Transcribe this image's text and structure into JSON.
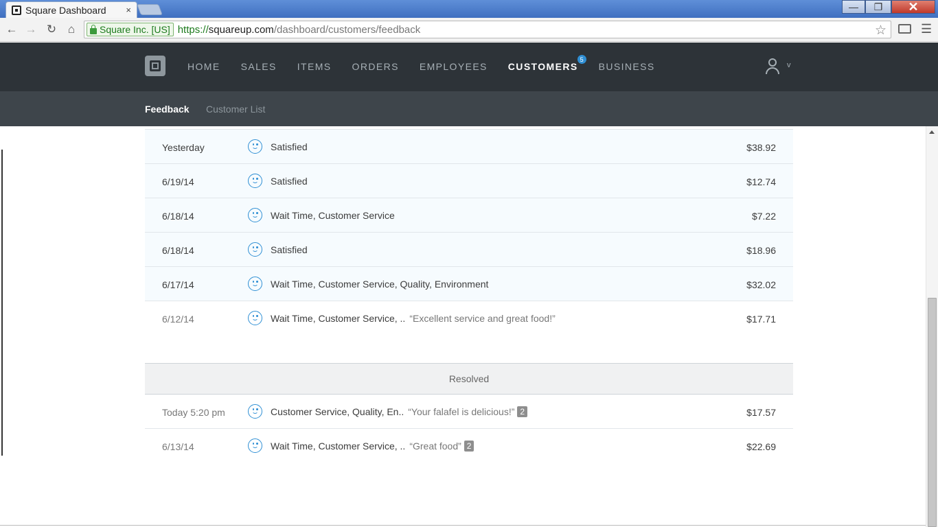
{
  "browser": {
    "tab_title": "Square Dashboard",
    "tab_close": "×",
    "ev_name": "Square Inc. [US]",
    "url_scheme": "https://",
    "url_host": "squareup.com",
    "url_path": "/dashboard/customers/feedback",
    "icons": [
      "back-icon",
      "forward-icon",
      "reload-icon",
      "home-icon",
      "lock-icon",
      "star-icon",
      "cast-icon",
      "menu-icon"
    ]
  },
  "nav": {
    "items": [
      {
        "label": "HOME"
      },
      {
        "label": "SALES"
      },
      {
        "label": "ITEMS"
      },
      {
        "label": "ORDERS"
      },
      {
        "label": "EMPLOYEES"
      },
      {
        "label": "CUSTOMERS",
        "active": true,
        "badge": "5"
      },
      {
        "label": "BUSINESS"
      }
    ],
    "user_caret": "v"
  },
  "subnav": {
    "feedback": "Feedback",
    "customer_list": "Customer List"
  },
  "feedback": [
    {
      "date": "Yesterday",
      "tags": "Satisfied",
      "quote": "",
      "count": "",
      "amount": "$38.92"
    },
    {
      "date": "6/19/14",
      "tags": "Satisfied",
      "quote": "",
      "count": "",
      "amount": "$12.74"
    },
    {
      "date": "6/18/14",
      "tags": "Wait Time, Customer Service",
      "quote": "",
      "count": "",
      "amount": "$7.22"
    },
    {
      "date": "6/18/14",
      "tags": "Satisfied",
      "quote": "",
      "count": "",
      "amount": "$18.96"
    },
    {
      "date": "6/17/14",
      "tags": "Wait Time, Customer Service, Quality, Environment",
      "quote": "",
      "count": "",
      "amount": "$32.02"
    },
    {
      "date": "6/12/14",
      "tags": "Wait Time, Customer Service, ..",
      "quote": "“Excellent service and great food!”",
      "count": "",
      "amount": "$17.71"
    }
  ],
  "resolved_label": "Resolved",
  "resolved": [
    {
      "date": "Today 5:20 pm",
      "tags": "Customer Service, Quality, En..",
      "quote": "“Your falafel is delicious!”",
      "count": "2",
      "amount": "$17.57"
    },
    {
      "date": "6/13/14",
      "tags": "Wait Time, Customer Service, ..",
      "quote": "“Great food”",
      "count": "2",
      "amount": "$22.69"
    }
  ],
  "colors": {
    "header_bg": "#2d3338",
    "subnav_bg": "#3e454b",
    "accent": "#2f8fd4"
  }
}
